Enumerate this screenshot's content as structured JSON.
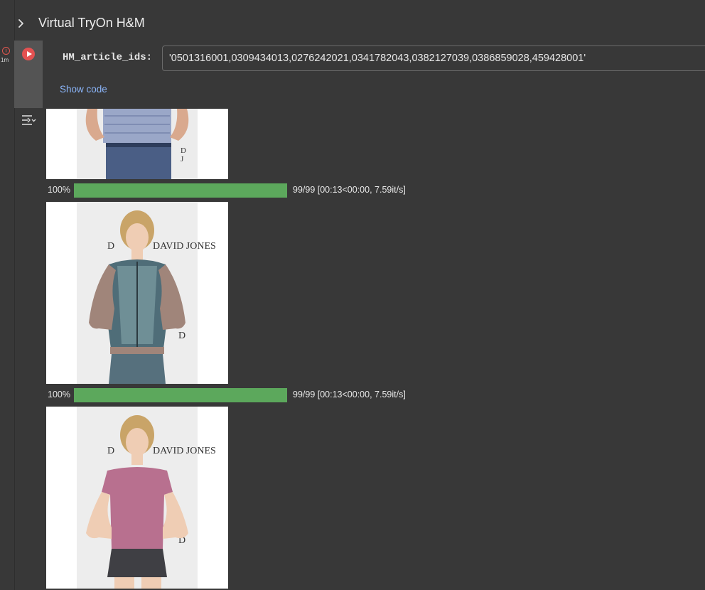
{
  "section": {
    "title": "Virtual TryOn H&M"
  },
  "cell": {
    "exec_time": "1m",
    "status": "error",
    "param_label": "HM_article_ids:",
    "param_value": "'0501316001,0309434013,0276242021,0341782043,0382127039,0386859028,459428001'",
    "show_code_label": "Show code"
  },
  "outputs": {
    "image_caption_text": "DAVID JONES",
    "progress_bars": [
      {
        "percent_label": "100%",
        "fraction": 1.0,
        "stats": "99/99 [00:13<00:00,  7.59it/s]"
      },
      {
        "percent_label": "100%",
        "fraction": 1.0,
        "stats": "99/99 [00:13<00:00,  7.59it/s]"
      }
    ]
  },
  "colors": {
    "background": "#383838",
    "run_button": "#e35151",
    "progress_fill": "#5ca85c",
    "link": "#8ab4f8",
    "error": "#e0574f"
  },
  "icons": {
    "section_toggle": "chevron-right-icon",
    "run": "run-cell-icon",
    "status": "error-circle-icon",
    "output_toggle": "output-toggle-icon"
  }
}
